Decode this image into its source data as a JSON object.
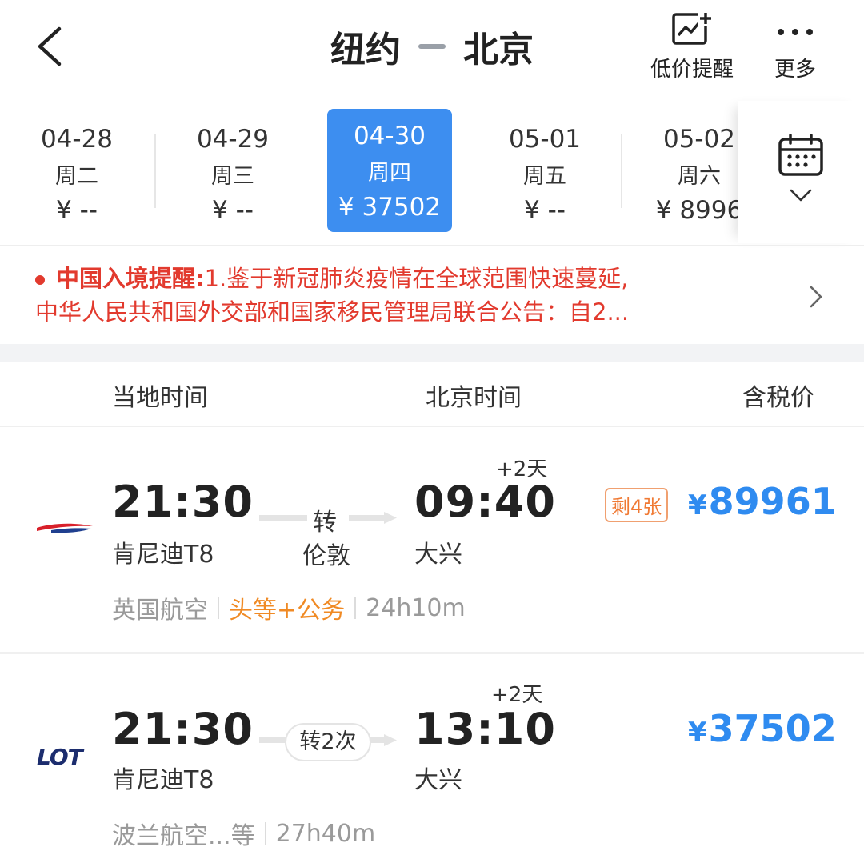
{
  "header": {
    "origin": "纽约",
    "destination": "北京",
    "price_alert_label": "低价提醒",
    "more_label": "更多"
  },
  "dates": [
    {
      "date": "04-28",
      "weekday": "周二",
      "price": "¥ --"
    },
    {
      "date": "04-29",
      "weekday": "周三",
      "price": "¥ --"
    },
    {
      "date": "04-30",
      "weekday": "周四",
      "price": "¥ 37502",
      "selected": true
    },
    {
      "date": "05-01",
      "weekday": "周五",
      "price": "¥ --"
    },
    {
      "date": "05-02",
      "weekday": "周六",
      "price": "¥ 8996"
    }
  ],
  "notice": {
    "title": "中国入境提醒:",
    "line1": "1.鉴于新冠肺炎疫情在全球范围快速蔓延,",
    "line2": "中华人民共和国外交部和国家移民管理局联合公告：自2..."
  },
  "columns": {
    "local_time": "当地时间",
    "beijing_time": "北京时间",
    "price_incl_tax": "含税价"
  },
  "flights": [
    {
      "airline": "英国航空",
      "airline_logo": "british-airways-logo",
      "dep_time": "21:30",
      "dep_airport": "肯尼迪T8",
      "transfer_label": "转",
      "transfer_city": "伦敦",
      "arr_time": "09:40",
      "arr_airport": "大兴",
      "day_offset": "+2天",
      "seats_left": "剩4张",
      "price_symbol": "¥",
      "price": "89961",
      "cabin": "头等+公务",
      "duration": "24h10m"
    },
    {
      "airline": "波兰航空...等",
      "airline_logo": "lot-logo",
      "logo_text": "LOT",
      "dep_time": "21:30",
      "dep_airport": "肯尼迪T8",
      "transfer_label": "转2次",
      "arr_time": "13:10",
      "arr_airport": "大兴",
      "day_offset": "+2天",
      "price_symbol": "¥",
      "price": "37502",
      "duration": "27h40m"
    }
  ],
  "colors": {
    "accent": "#3d8ef0",
    "price": "#2f8bf0",
    "notice": "#e23a2e",
    "cabin": "#f08a24"
  }
}
